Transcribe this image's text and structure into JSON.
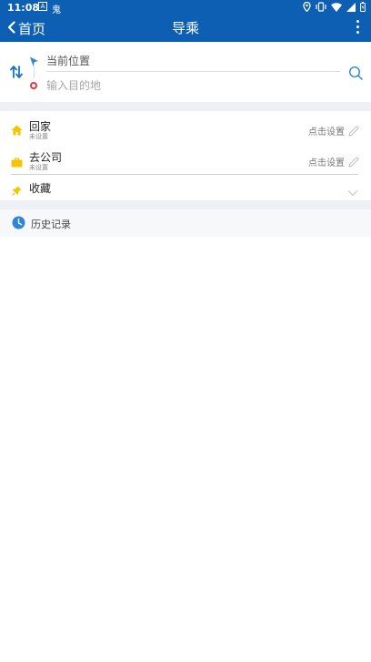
{
  "status_bar": {
    "time": "11:08",
    "notif_a": "A",
    "notif_b": "鬼"
  },
  "app_bar": {
    "back_label": "首页",
    "title": "导乘"
  },
  "route": {
    "from_text": "当前位置",
    "to_placeholder": "输入目的地"
  },
  "favorites": {
    "items": [
      {
        "name": "回家",
        "sub": "未设置",
        "action": "点击设置"
      },
      {
        "name": "去公司",
        "sub": "未设置",
        "action": "点击设置"
      }
    ],
    "collect_label": "收藏"
  },
  "history": {
    "label": "历史记录"
  },
  "colors": {
    "primary": "#0d5fb3",
    "accent_yellow": "#f5c400",
    "history_icon": "#2f86d6",
    "destination_red": "#e23a3a"
  }
}
